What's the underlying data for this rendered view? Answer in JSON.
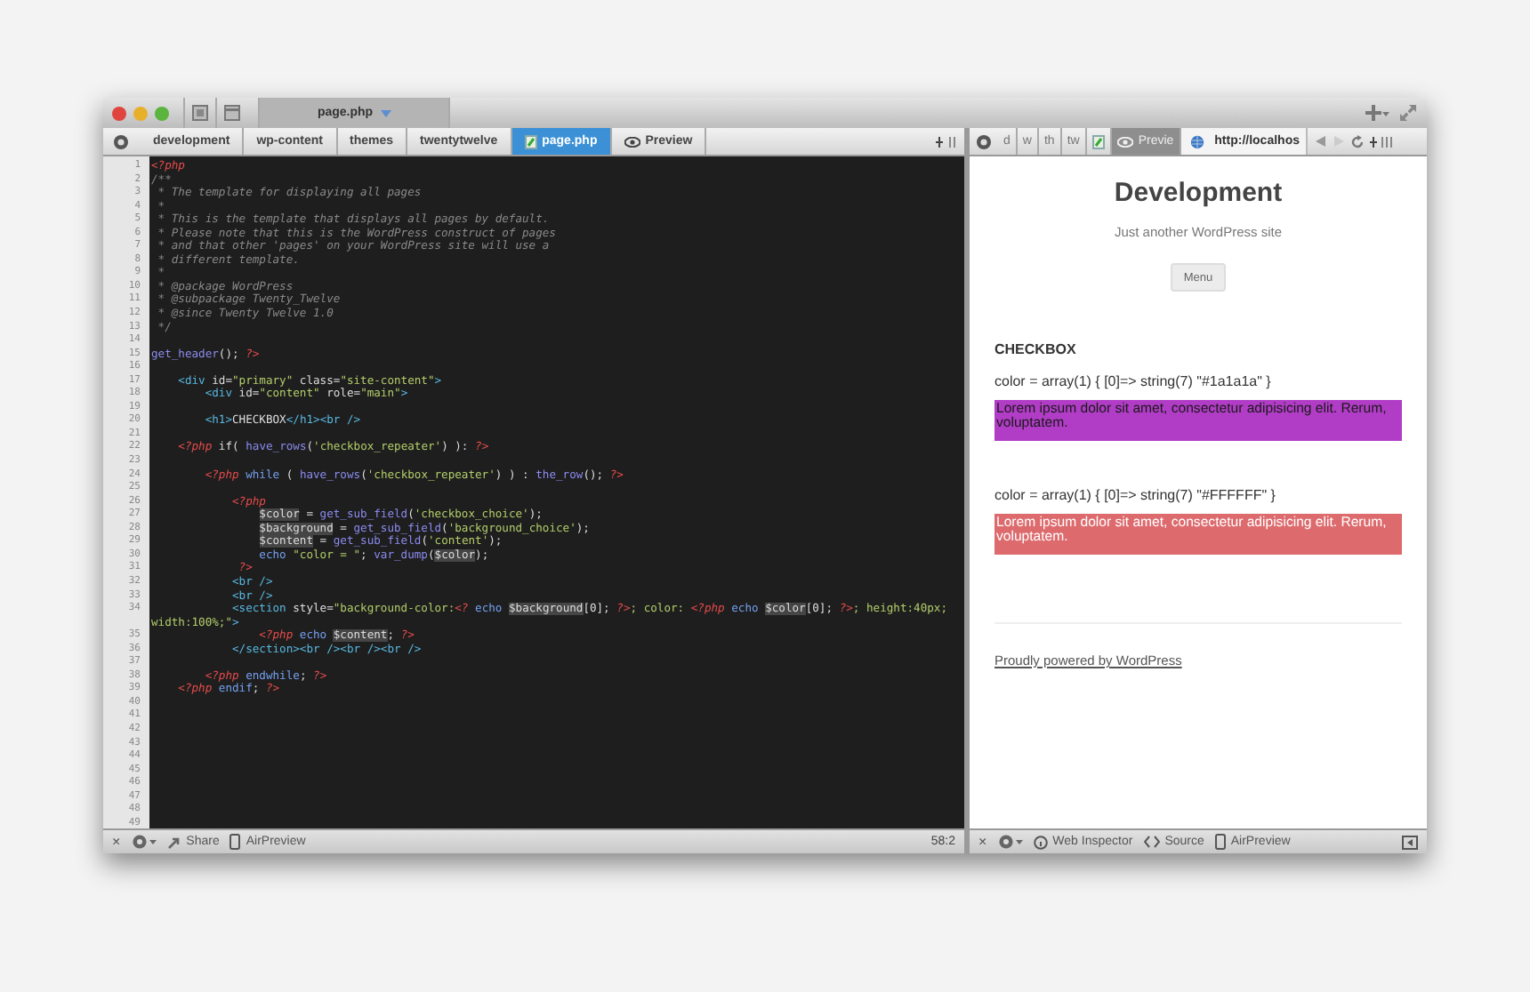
{
  "window": {
    "tab": {
      "label": "page.php",
      "selected": true
    }
  },
  "editor": {
    "breadcrumbs": [
      {
        "kind": "folder",
        "label": "development",
        "selected": false
      },
      {
        "kind": "folder",
        "label": "wp-content",
        "selected": false
      },
      {
        "kind": "folder",
        "label": "themes",
        "selected": false
      },
      {
        "kind": "folder",
        "label": "twentytwelve",
        "selected": false
      },
      {
        "kind": "file",
        "label": "page.php",
        "selected": true
      },
      {
        "kind": "preview",
        "label": "Preview",
        "selected": false
      }
    ],
    "lines": [
      {
        "n": "1",
        "code": [
          {
            "kind": "php",
            "text": "<?php"
          }
        ]
      },
      {
        "n": "2",
        "code": [
          {
            "kind": "cm",
            "text": "/**"
          }
        ]
      },
      {
        "n": "3",
        "code": [
          {
            "kind": "cm",
            "text": " * The template for displaying all pages"
          }
        ]
      },
      {
        "n": "4",
        "code": [
          {
            "kind": "cm",
            "text": " *"
          }
        ]
      },
      {
        "n": "5",
        "code": [
          {
            "kind": "cm",
            "text": " * This is the template that displays all pages by default."
          }
        ]
      },
      {
        "n": "6",
        "code": [
          {
            "kind": "cm",
            "text": " * Please note that this is the WordPress construct of pages"
          }
        ]
      },
      {
        "n": "7",
        "code": [
          {
            "kind": "cm",
            "text": " * and that other 'pages' on your WordPress site will use a"
          }
        ]
      },
      {
        "n": "8",
        "code": [
          {
            "kind": "cm",
            "text": " * different template."
          }
        ]
      },
      {
        "n": "9",
        "code": [
          {
            "kind": "cm",
            "text": " *"
          }
        ]
      },
      {
        "n": "10",
        "code": [
          {
            "kind": "cm",
            "text": " * @package WordPress"
          }
        ]
      },
      {
        "n": "11",
        "code": [
          {
            "kind": "cm",
            "text": " * @subpackage Twenty_Twelve"
          }
        ]
      },
      {
        "n": "12",
        "code": [
          {
            "kind": "cm",
            "text": " * @since Twenty Twelve 1.0"
          }
        ]
      },
      {
        "n": "13",
        "code": [
          {
            "kind": "cm",
            "text": " */"
          }
        ]
      },
      {
        "n": "14"
      },
      {
        "n": "15",
        "code": [
          {
            "kind": "fn",
            "text": "get_header"
          },
          {
            "kind": "p",
            "text": "(); "
          },
          {
            "kind": "php",
            "text": "?>"
          }
        ]
      },
      {
        "n": "16"
      },
      {
        "n": "17",
        "code": [
          {
            "kind": "tag",
            "text": "    <div"
          },
          {
            "kind": "p",
            "text": " id="
          },
          {
            "kind": "str",
            "text": "\"primary\""
          },
          {
            "kind": "p",
            "text": " class="
          },
          {
            "kind": "str",
            "text": "\"site-content\""
          },
          {
            "kind": "tag",
            "text": ">"
          }
        ]
      },
      {
        "n": "18",
        "code": [
          {
            "kind": "tag",
            "text": "        <div"
          },
          {
            "kind": "p",
            "text": " id="
          },
          {
            "kind": "str",
            "text": "\"content\""
          },
          {
            "kind": "p",
            "text": " role="
          },
          {
            "kind": "str",
            "text": "\"main\""
          },
          {
            "kind": "tag",
            "text": ">"
          }
        ]
      },
      {
        "n": "19"
      },
      {
        "n": "20",
        "code": [
          {
            "kind": "tag",
            "text": "        <h1>"
          },
          {
            "kind": "p",
            "text": "CHECKBOX"
          },
          {
            "kind": "tag",
            "text": "</h1><br />"
          }
        ]
      },
      {
        "n": "21"
      },
      {
        "n": "22",
        "code": [
          {
            "kind": "php",
            "text": "    <?php"
          },
          {
            "kind": "p",
            "text": " if( "
          },
          {
            "kind": "fn",
            "text": "have_rows"
          },
          {
            "kind": "p",
            "text": "("
          },
          {
            "kind": "str",
            "text": "'checkbox_repeater'"
          },
          {
            "kind": "p",
            "text": ") ): "
          },
          {
            "kind": "php",
            "text": "?>"
          }
        ]
      },
      {
        "n": "23"
      },
      {
        "n": "24",
        "code": [
          {
            "kind": "php",
            "text": "        <?php"
          },
          {
            "kind": "kw",
            "text": " while"
          },
          {
            "kind": "p",
            "text": " ( "
          },
          {
            "kind": "fn",
            "text": "have_rows"
          },
          {
            "kind": "p",
            "text": "("
          },
          {
            "kind": "str",
            "text": "'checkbox_repeater'"
          },
          {
            "kind": "p",
            "text": ") ) : "
          },
          {
            "kind": "fn",
            "text": "the_row"
          },
          {
            "kind": "p",
            "text": "(); "
          },
          {
            "kind": "php",
            "text": "?>"
          }
        ]
      },
      {
        "n": "25"
      },
      {
        "n": "26",
        "code": [
          {
            "kind": "php",
            "text": "            <?php"
          }
        ]
      },
      {
        "n": "27",
        "code": [
          {
            "kind": "var",
            "text": "                $color"
          },
          {
            "kind": "p",
            "text": " = "
          },
          {
            "kind": "fn",
            "text": "get_sub_field"
          },
          {
            "kind": "p",
            "text": "("
          },
          {
            "kind": "str",
            "text": "'checkbox_choice'"
          },
          {
            "kind": "p",
            "text": ");"
          }
        ]
      },
      {
        "n": "28",
        "code": [
          {
            "kind": "var",
            "text": "                $background"
          },
          {
            "kind": "p",
            "text": " = "
          },
          {
            "kind": "fn",
            "text": "get_sub_field"
          },
          {
            "kind": "p",
            "text": "("
          },
          {
            "kind": "str",
            "text": "'background_choice'"
          },
          {
            "kind": "p",
            "text": ");"
          }
        ]
      },
      {
        "n": "29",
        "code": [
          {
            "kind": "var",
            "text": "                $content"
          },
          {
            "kind": "p",
            "text": " = "
          },
          {
            "kind": "fn",
            "text": "get_sub_field"
          },
          {
            "kind": "p",
            "text": "("
          },
          {
            "kind": "str",
            "text": "'content'"
          },
          {
            "kind": "p",
            "text": ");"
          }
        ]
      },
      {
        "n": "30",
        "code": [
          {
            "kind": "kw",
            "text": "                echo"
          },
          {
            "kind": "str",
            "text": " \"color = \""
          },
          {
            "kind": "p",
            "text": "; "
          },
          {
            "kind": "fn",
            "text": "var_dump"
          },
          {
            "kind": "p",
            "text": "("
          },
          {
            "kind": "var",
            "text": "$color"
          },
          {
            "kind": "p",
            "text": ");"
          }
        ]
      },
      {
        "n": "31",
        "code": [
          {
            "kind": "php",
            "text": "             ?>"
          }
        ]
      },
      {
        "n": "32",
        "code": [
          {
            "kind": "tag",
            "text": "            <br />"
          }
        ]
      },
      {
        "n": "33",
        "code": [
          {
            "kind": "tag",
            "text": "            <br />"
          }
        ]
      },
      {
        "n": "34",
        "code": [
          {
            "kind": "tag",
            "text": "            <section"
          },
          {
            "kind": "p",
            "text": " style="
          },
          {
            "kind": "str",
            "text": "\"background-color:"
          },
          {
            "kind": "php",
            "text": "<?"
          },
          {
            "kind": "kw",
            "text": " echo "
          },
          {
            "kind": "var",
            "text": "$background"
          },
          {
            "kind": "p",
            "text": "[0]; "
          },
          {
            "kind": "php",
            "text": "?>"
          },
          {
            "kind": "str",
            "text": "; color: "
          },
          {
            "kind": "php",
            "text": "<?php"
          },
          {
            "kind": "kw",
            "text": " echo "
          },
          {
            "kind": "var",
            "text": "$color"
          },
          {
            "kind": "p",
            "text": "[0]; "
          },
          {
            "kind": "php",
            "text": "?>"
          },
          {
            "kind": "str",
            "text": "; height:40px; width:100%;\""
          },
          {
            "kind": "tag",
            "text": ">"
          }
        ]
      },
      {
        "n": "35",
        "code": [
          {
            "kind": "php",
            "text": "                <?php"
          },
          {
            "kind": "kw",
            "text": " echo "
          },
          {
            "kind": "var",
            "text": "$content"
          },
          {
            "kind": "p",
            "text": "; "
          },
          {
            "kind": "php",
            "text": "?>"
          }
        ]
      },
      {
        "n": "36",
        "code": [
          {
            "kind": "tag",
            "text": "            </section><br /><br /><br />"
          }
        ]
      },
      {
        "n": "37"
      },
      {
        "n": "38",
        "code": [
          {
            "kind": "php",
            "text": "        <?php"
          },
          {
            "kind": "kw",
            "text": " endwhile"
          },
          {
            "kind": "p",
            "text": "; "
          },
          {
            "kind": "php",
            "text": "?>"
          }
        ]
      },
      {
        "n": "39",
        "code": [
          {
            "kind": "php",
            "text": "    <?php"
          },
          {
            "kind": "kw",
            "text": " endif"
          },
          {
            "kind": "p",
            "text": "; "
          },
          {
            "kind": "php",
            "text": "?>"
          }
        ]
      },
      {
        "n": "40"
      },
      {
        "n": "41"
      },
      {
        "n": "42"
      },
      {
        "n": "43"
      },
      {
        "n": "44"
      },
      {
        "n": "45"
      },
      {
        "n": "46"
      },
      {
        "n": "47"
      },
      {
        "n": "48"
      },
      {
        "n": "49"
      }
    ],
    "status": {
      "close": "×",
      "share": "Share",
      "airpreview": "AirPreview",
      "position": "58:2"
    }
  },
  "preview": {
    "breadcrumbs": [
      {
        "kind": "folder",
        "label": "d",
        "selected": false
      },
      {
        "kind": "folder",
        "label": "w",
        "selected": false
      },
      {
        "kind": "folder",
        "label": "th",
        "selected": false
      },
      {
        "kind": "folder",
        "label": "tw",
        "selected": false
      },
      {
        "kind": "file",
        "selected": false
      },
      {
        "kind": "preview",
        "label": "Previe",
        "selected": true
      }
    ],
    "url": "http://localhos",
    "site_title": "Development",
    "tagline": "Just another WordPress site",
    "menu": "Menu",
    "heading": "CHECKBOX",
    "entries": [
      {
        "dump": "color = array(1) { [0]=> string(7) \"#1a1a1a\" }",
        "text": "Lorem ipsum dolor sit amet, consectetur adipisicing elit. Rerum, voluptatem.",
        "color": "#b13cc6",
        "kind": "dark_text"
      },
      {
        "dump": "color = array(1) { [0]=> string(7) \"#FFFFFF\" }",
        "text": "Lorem ipsum dolor sit amet, consectetur adipisicing elit. Rerum, voluptatem.",
        "color": "#dd6b6e",
        "kind": "light_text"
      }
    ],
    "footer_link": "Proudly powered by WordPress",
    "status": {
      "close": "×",
      "inspector": "Web Inspector",
      "source": "Source",
      "airpreview": "AirPreview"
    }
  }
}
